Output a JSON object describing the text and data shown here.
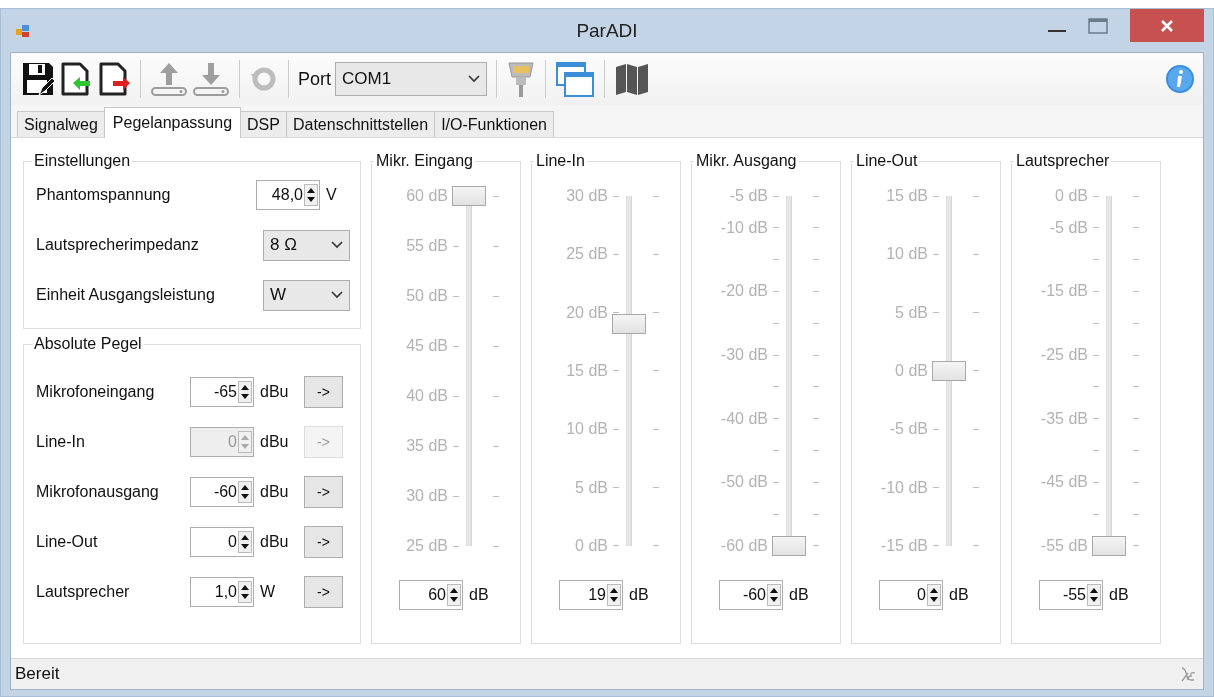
{
  "window": {
    "title": "ParADI"
  },
  "toolbar": {
    "port_label": "Port",
    "port_value": "COM1",
    "disabled": [
      false,
      false,
      false,
      true,
      true,
      true
    ]
  },
  "tabs": [
    {
      "label": "Signalweg",
      "selected": false
    },
    {
      "label": "Pegelanpassung",
      "selected": true
    },
    {
      "label": "DSP",
      "selected": false
    },
    {
      "label": "Datenschnittstellen",
      "selected": false
    },
    {
      "label": "I/O-Funktionen",
      "selected": false
    }
  ],
  "settings": {
    "title": "Einstellungen",
    "rows": [
      {
        "label": "Phantomspannung",
        "kind": "spin",
        "value": "48,0",
        "unit": "V"
      },
      {
        "label": "Lautsprecherimpedanz",
        "kind": "combo",
        "value": "8 Ω"
      },
      {
        "label": "Einheit Ausgangsleistung",
        "kind": "combo",
        "value": "W"
      }
    ]
  },
  "levels": {
    "title": "Absolute Pegel",
    "button": [
      "->",
      "->",
      "->",
      "->",
      "->"
    ],
    "rows": [
      {
        "label": "Mikrofoneingang",
        "value": "-65",
        "unit": "dBu",
        "disabled": false
      },
      {
        "label": "Line-In",
        "value": "0",
        "unit": "dBu",
        "disabled": true
      },
      {
        "label": "Mikrofonausgang",
        "value": "-60",
        "unit": "dBu",
        "disabled": false
      },
      {
        "label": "Line-Out",
        "value": "0",
        "unit": "dBu",
        "disabled": false
      },
      {
        "label": "Lautsprecher",
        "value": "1,0",
        "unit": "W",
        "disabled": false
      }
    ]
  },
  "channels": [
    {
      "title": "Mikr. Eingang",
      "level": 1,
      "value": "60",
      "unit": "dB",
      "ticks": [
        {
          "kind": "major",
          "label": "60 dB"
        },
        {
          "kind": "major",
          "label": "55 dB"
        },
        {
          "kind": "major",
          "label": "50 dB"
        },
        {
          "kind": "major",
          "label": "45 dB"
        },
        {
          "kind": "major",
          "label": "40 dB"
        },
        {
          "kind": "major",
          "label": "35 dB"
        },
        {
          "kind": "major",
          "label": "30 dB"
        },
        {
          "kind": "major",
          "label": "25 dB"
        }
      ]
    },
    {
      "title": "Line-In",
      "level": 0.633,
      "value": "19",
      "unit": "dB",
      "ticks": [
        {
          "kind": "major",
          "label": "30 dB"
        },
        {
          "kind": "major",
          "label": "25 dB"
        },
        {
          "kind": "major",
          "label": "20 dB"
        },
        {
          "kind": "major",
          "label": "15 dB"
        },
        {
          "kind": "major",
          "label": "10 dB"
        },
        {
          "kind": "major",
          "label": "5 dB"
        },
        {
          "kind": "major",
          "label": "0 dB"
        }
      ]
    },
    {
      "title": "Mikr. Ausgang",
      "level": 0,
      "value": "-60",
      "unit": "dB",
      "ticks": [
        {
          "kind": "major",
          "label": "-5 dB"
        },
        {
          "kind": "major",
          "label": "-10 dB"
        },
        {
          "kind": "minor"
        },
        {
          "kind": "major",
          "label": "-20 dB"
        },
        {
          "kind": "minor"
        },
        {
          "kind": "major",
          "label": "-30 dB"
        },
        {
          "kind": "minor"
        },
        {
          "kind": "major",
          "label": "-40 dB"
        },
        {
          "kind": "minor"
        },
        {
          "kind": "major",
          "label": "-50 dB"
        },
        {
          "kind": "minor"
        },
        {
          "kind": "major",
          "label": "-60 dB"
        }
      ]
    },
    {
      "title": "Line-Out",
      "level": 0.5,
      "value": "0",
      "unit": "dB",
      "ticks": [
        {
          "kind": "major",
          "label": "15 dB"
        },
        {
          "kind": "major",
          "label": "10 dB"
        },
        {
          "kind": "major",
          "label": "5 dB"
        },
        {
          "kind": "major",
          "label": "0 dB"
        },
        {
          "kind": "major",
          "label": "-5 dB"
        },
        {
          "kind": "major",
          "label": "-10 dB"
        },
        {
          "kind": "major",
          "label": "-15 dB"
        }
      ]
    },
    {
      "title": "Lautsprecher",
      "level": 0,
      "value": "-55",
      "unit": "dB",
      "ticks": [
        {
          "kind": "major",
          "label": "0 dB"
        },
        {
          "kind": "major",
          "label": "-5 dB"
        },
        {
          "kind": "minor"
        },
        {
          "kind": "major",
          "label": "-15 dB"
        },
        {
          "kind": "minor"
        },
        {
          "kind": "major",
          "label": "-25 dB"
        },
        {
          "kind": "minor"
        },
        {
          "kind": "major",
          "label": "-35 dB"
        },
        {
          "kind": "minor"
        },
        {
          "kind": "major",
          "label": "-45 dB"
        },
        {
          "kind": "minor"
        },
        {
          "kind": "major",
          "label": "-55 dB"
        }
      ]
    }
  ],
  "status_bar": {
    "text": "Bereit"
  }
}
